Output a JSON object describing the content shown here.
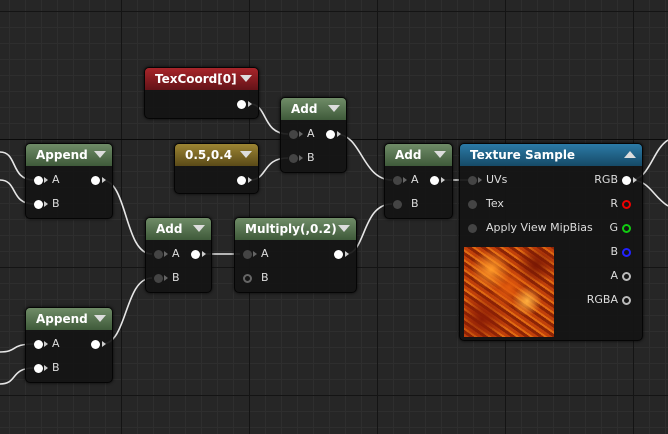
{
  "graph": {
    "nodes": {
      "texcoord": {
        "title": "TexCoord[0]"
      },
      "const_vec": {
        "title": "0.5,0.4"
      },
      "add_top": {
        "title": "Add",
        "pin_a": "A",
        "pin_b": "B"
      },
      "add_right": {
        "title": "Add",
        "pin_a": "A",
        "pin_b": "B"
      },
      "append_top": {
        "title": "Append",
        "pin_a": "A",
        "pin_b": "B"
      },
      "append_bottom": {
        "title": "Append",
        "pin_a": "A",
        "pin_b": "B"
      },
      "add_mid": {
        "title": "Add",
        "pin_a": "A",
        "pin_b": "B"
      },
      "multiply": {
        "title": "Multiply(,0.2)",
        "pin_a": "A",
        "pin_b": "B"
      },
      "texture_sample": {
        "title": "Texture Sample",
        "inputs": [
          "UVs",
          "Tex",
          "Apply View MipBias"
        ],
        "outputs": [
          "RGB",
          "R",
          "G",
          "B",
          "A",
          "RGBA"
        ],
        "thumbnail": "orange-lava-texture"
      }
    },
    "colors": {
      "header_green": "#4f6b49",
      "header_red": "#8a1a1f",
      "header_gold": "#7a6624",
      "header_blue": "#1f6088",
      "wire": "#e8e8e8"
    }
  }
}
